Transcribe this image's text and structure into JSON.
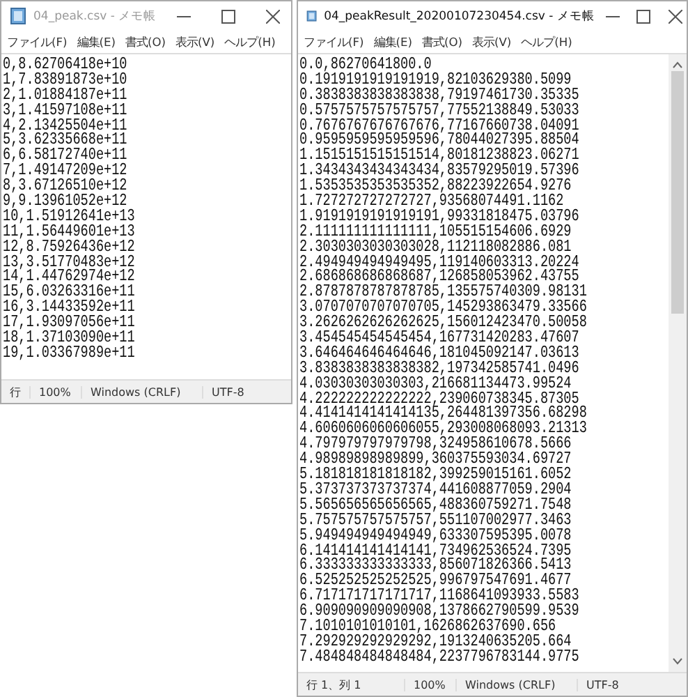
{
  "windows": [
    {
      "title": "04_peak.csv - メモ帳",
      "active": false,
      "menu": [
        "ファイル(F)",
        "編集(E)",
        "書式(O)",
        "表示(V)",
        "ヘルプ(H)"
      ],
      "lines": [
        "0,8.62706418e+10",
        "1,7.83891873e+10",
        "2,1.01884187e+11",
        "3,1.41597108e+11",
        "4,2.13425504e+11",
        "5,3.62335668e+11",
        "6,6.58172740e+11",
        "7,1.49147209e+12",
        "8,3.67126510e+12",
        "9,9.13961052e+12",
        "10,1.51912641e+13",
        "11,1.56449601e+13",
        "12,8.75926436e+12",
        "13,3.51770483e+12",
        "14,1.44762974e+12",
        "15,6.03263316e+11",
        "16,3.14433592e+11",
        "17,1.93097056e+11",
        "18,1.37103090e+11",
        "19,1.03367989e+11"
      ],
      "status": [
        "行",
        "100%",
        "Windows (CRLF)",
        "UTF-8"
      ]
    },
    {
      "title": "04_peakResult_20200107230454.csv - メモ帳",
      "active": true,
      "scrollbar": true,
      "menu": [
        "ファイル(F)",
        "編集(E)",
        "書式(O)",
        "表示(V)",
        "ヘルプ(H)"
      ],
      "lines": [
        "0.0,86270641800.0",
        "0.1919191919191919,82103629380.5099",
        "0.3838383838383838,79197461730.35335",
        "0.5757575757575757,77552138849.53033",
        "0.7676767676767676,77167660738.04091",
        "0.9595959595959596,78044027395.88504",
        "1.1515151515151514,80181238823.06271",
        "1.3434343434343434,83579295019.57396",
        "1.5353535353535352,88223922654.9276",
        "1.727272727272727,93568074491.1162",
        "1.9191919191919191,99331818475.03796",
        "2.111111111111111,105515154606.6929",
        "2.3030303030303028,112118082886.081",
        "2.494949494949495,119140603313.20224",
        "2.686868686868687,126858053962.43755",
        "2.8787878787878785,135575740309.98131",
        "3.0707070707070705,145293863479.33566",
        "3.2626262626262625,156012423470.50058",
        "3.454545454545454,167731420283.47607",
        "3.646464646464646,181045092147.03613",
        "3.8383838383838382,197342585741.0496",
        "4.03030303030303,216681134473.99524",
        "4.222222222222222,239060738345.87305",
        "4.4141414141414135,264481397356.68298",
        "4.6060606060606055,293008068093.21313",
        "4.797979797979798,324958610678.5666",
        "4.98989898989899,360375593034.69727",
        "5.181818181818182,399259015161.6052",
        "5.373737373737374,441608877059.2904",
        "5.565656565656565,488360759271.7548",
        "5.757575757575757,551107002977.3463",
        "5.949494949494949,633307595395.0078",
        "6.141414141414141,734962536524.7395",
        "6.333333333333333,856071826366.5413",
        "6.525252525252525,996797547691.4677",
        "6.717171717171717,1168641093933.5583",
        "6.909090909090908,1378662790599.9539",
        "7.1010101010101,1626862637690.656",
        "7.292929292929292,1913240635205.664",
        "7.484848484848484,2237796783144.9775"
      ],
      "status": [
        "行 1、列 1",
        "100%",
        "Windows (CRLF)",
        "UTF-8"
      ]
    }
  ]
}
